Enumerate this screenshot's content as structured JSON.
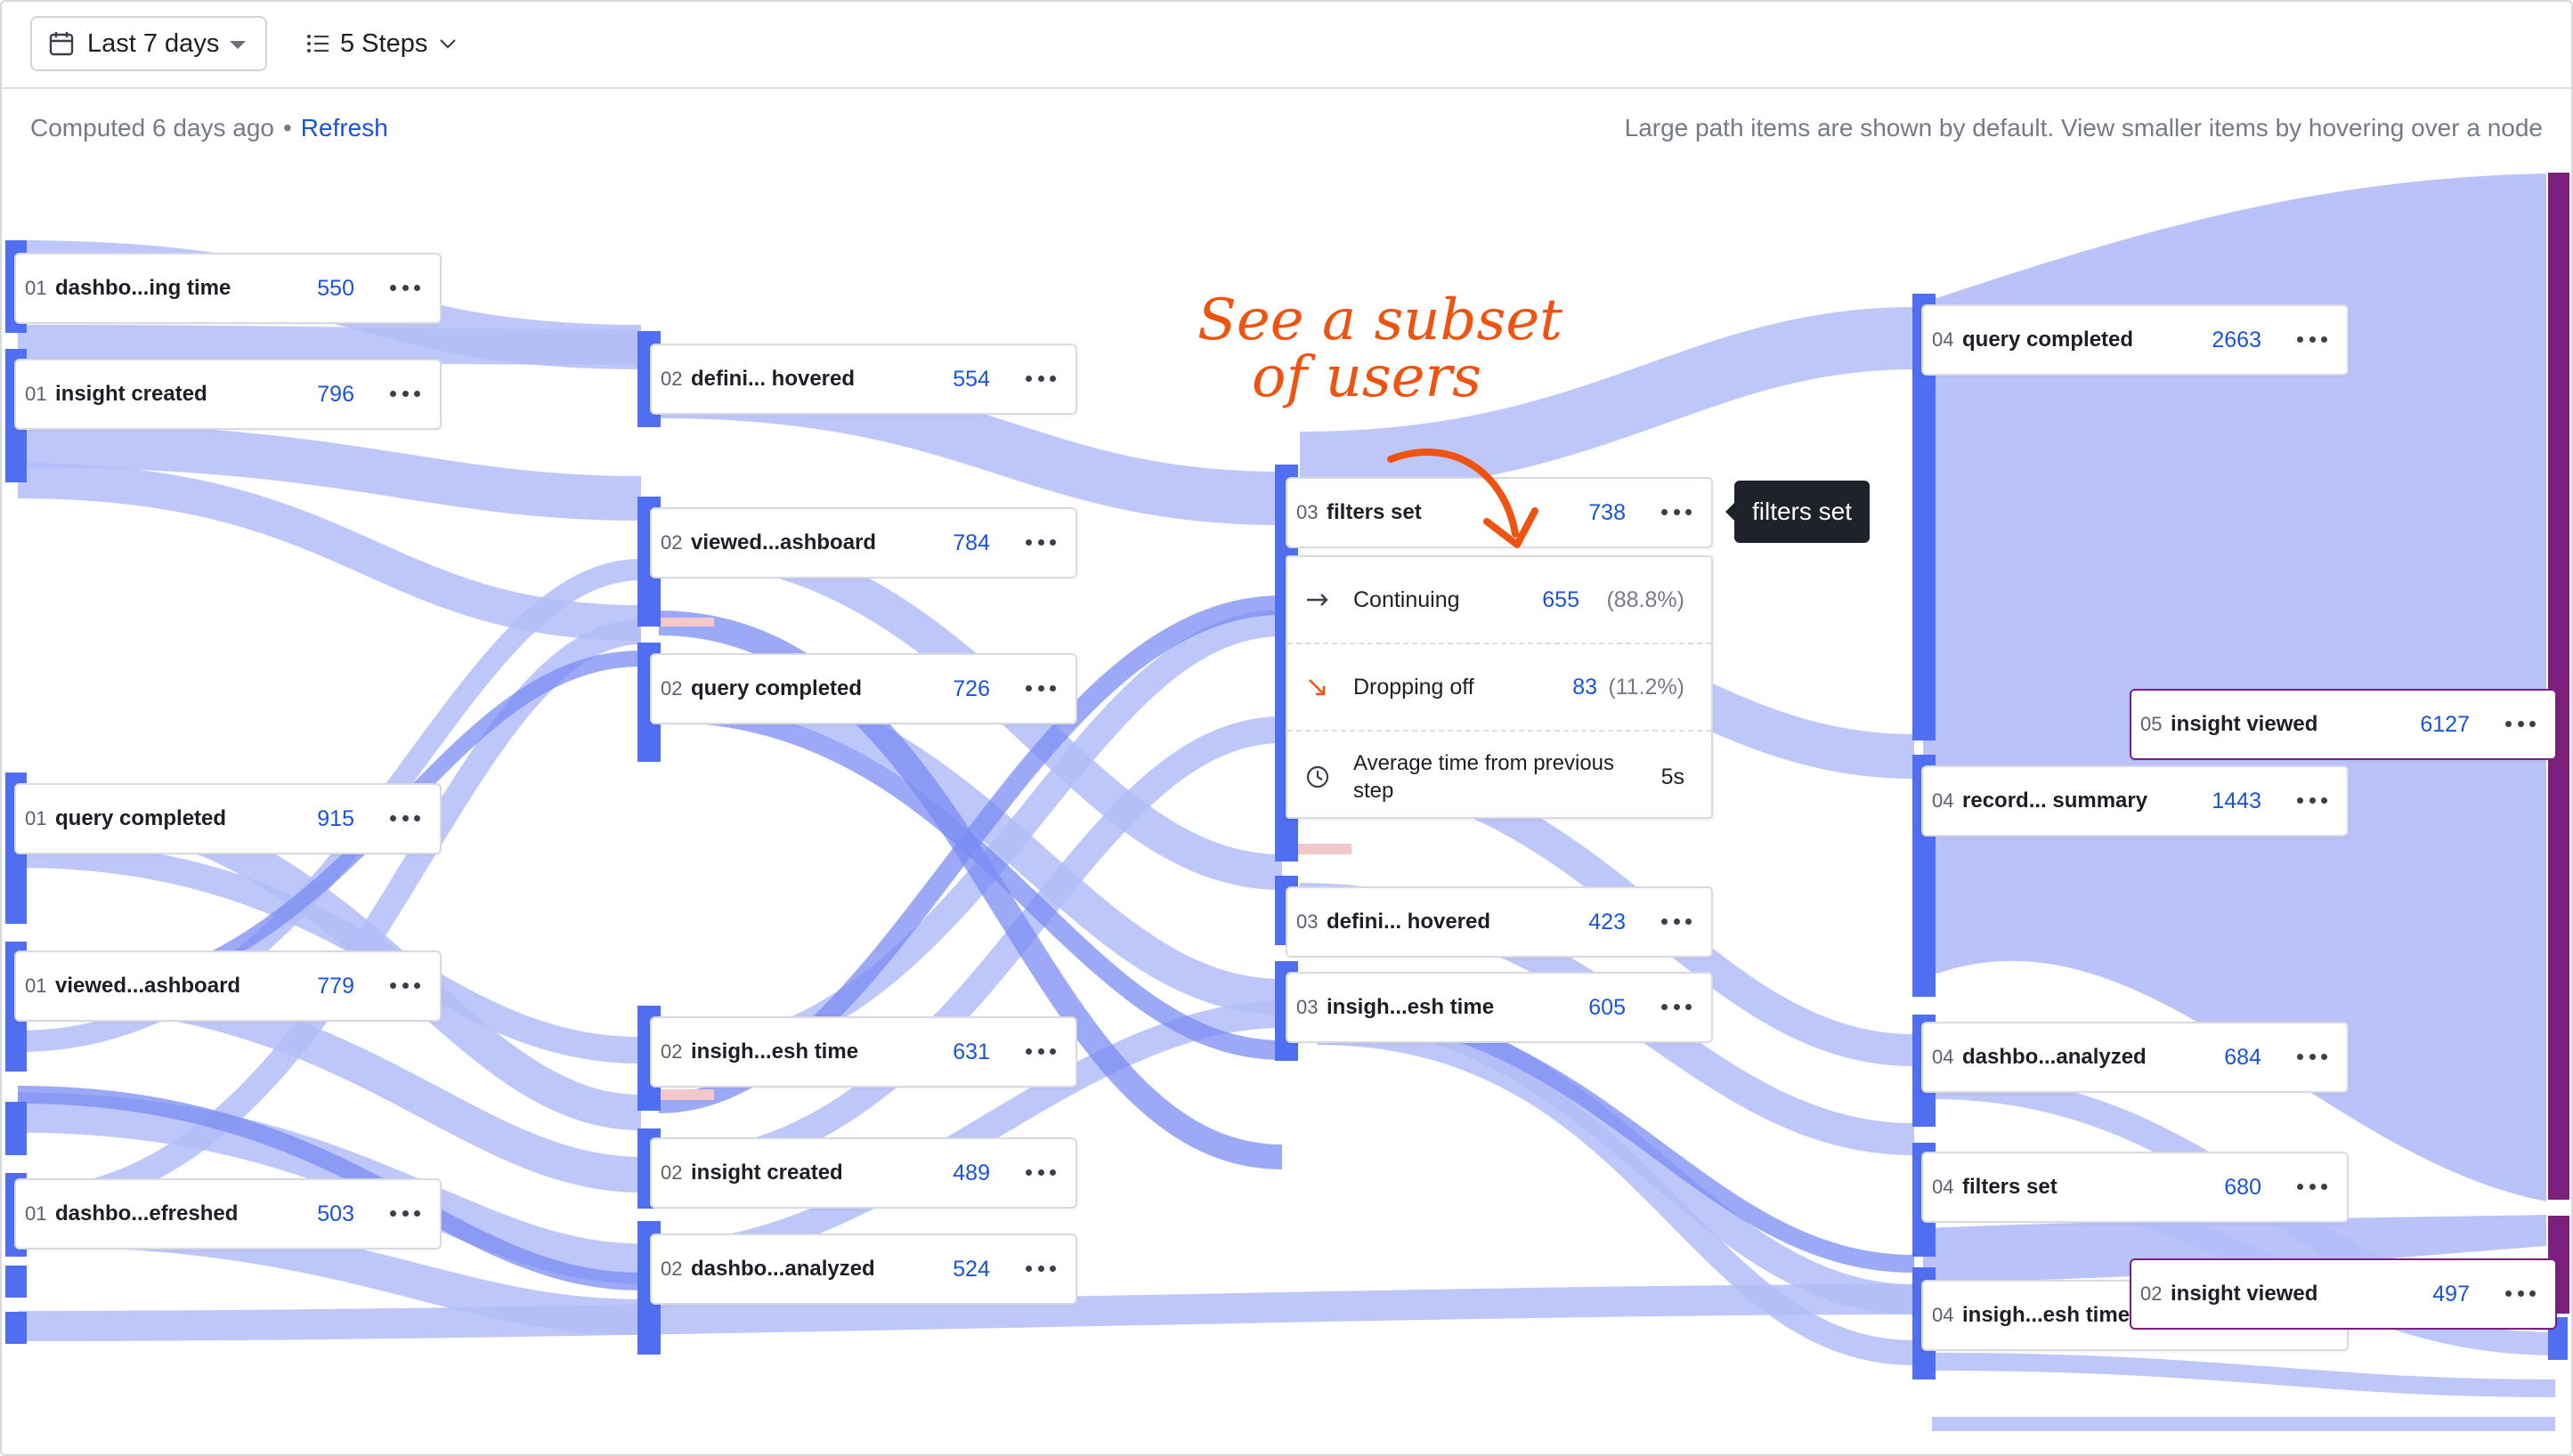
{
  "toolbar": {
    "date_range": "Last 7 days",
    "steps": "5 Steps"
  },
  "status": {
    "computed": "Computed 6 days ago",
    "separator": "•",
    "refresh": "Refresh",
    "hint": "Large path items are shown by default. View smaller items by hovering over a node"
  },
  "nodes": {
    "n01a": {
      "step": "01",
      "name": "dashbo...ing time",
      "count": "550"
    },
    "n01b": {
      "step": "01",
      "name": "insight created",
      "count": "796"
    },
    "n01c": {
      "step": "01",
      "name": "query completed",
      "count": "915"
    },
    "n01d": {
      "step": "01",
      "name": "viewed...ashboard",
      "count": "779"
    },
    "n01e": {
      "step": "01",
      "name": "dashbo...efreshed",
      "count": "503"
    },
    "n02a": {
      "step": "02",
      "name": "defini... hovered",
      "count": "554"
    },
    "n02b": {
      "step": "02",
      "name": "viewed...ashboard",
      "count": "784"
    },
    "n02c": {
      "step": "02",
      "name": "query completed",
      "count": "726"
    },
    "n02d": {
      "step": "02",
      "name": "insigh...esh time",
      "count": "631"
    },
    "n02e": {
      "step": "02",
      "name": "insight created",
      "count": "489"
    },
    "n02f": {
      "step": "02",
      "name": "dashbo...analyzed",
      "count": "524"
    },
    "n03a": {
      "step": "03",
      "name": "filters set",
      "count": "738"
    },
    "n03b": {
      "step": "03",
      "name": "defini... hovered",
      "count": "423"
    },
    "n03c": {
      "step": "03",
      "name": "insigh...esh time",
      "count": "605"
    },
    "n04a": {
      "step": "04",
      "name": "query completed",
      "count": "2663"
    },
    "n04b": {
      "step": "04",
      "name": "record... summary",
      "count": "1443"
    },
    "n04c": {
      "step": "04",
      "name": "dashbo...analyzed",
      "count": "684"
    },
    "n04d": {
      "step": "04",
      "name": "filters set",
      "count": "680"
    },
    "n04e": {
      "step": "04",
      "name": "insigh...esh time",
      "count": ""
    },
    "n05a": {
      "step": "05",
      "name": "insight viewed",
      "count": "6127"
    },
    "n02g": {
      "step": "02",
      "name": "insight viewed",
      "count": "497"
    }
  },
  "popup": {
    "continuing_label": "Continuing",
    "continuing_value": "655",
    "continuing_pct": "(88.8%)",
    "dropping_label": "Dropping off",
    "dropping_value": "83",
    "dropping_pct": "(11.2%)",
    "avg_label_line1": "Average time from previous",
    "avg_label_line2": "step",
    "avg_value": "5s"
  },
  "tooltip": "filters set",
  "annotation": {
    "line1": "See a subset",
    "line2": "of users"
  },
  "colors": {
    "flow": "#b3bdf8",
    "flow_dark": "#7a8cf3",
    "node_bar": "#4f6ef0",
    "purple_bar": "#7c1f7d",
    "count": "#1a54d6",
    "annotation": "#f0520f"
  }
}
